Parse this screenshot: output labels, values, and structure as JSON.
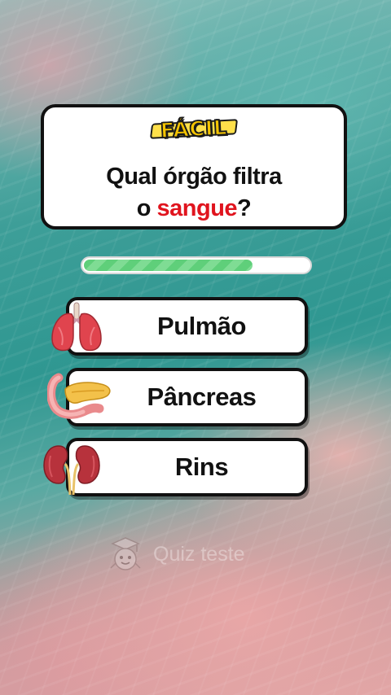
{
  "quiz": {
    "difficulty": "FÁCIL",
    "question_line1": "Qual órgão filtra",
    "question_prefix": "o ",
    "question_highlight": "sangue",
    "question_suffix": "?",
    "progress_fraction": 0.75,
    "options": [
      {
        "label": "Pulmão",
        "icon": "lungs-icon"
      },
      {
        "label": "Pâncreas",
        "icon": "pancreas-icon"
      },
      {
        "label": "Rins",
        "icon": "kidneys-icon"
      }
    ]
  },
  "watermark": {
    "text": "Quiz teste",
    "icon": "mascot-icon"
  },
  "colors": {
    "highlight": "#e0141e",
    "progress": "#5fcf7a",
    "badge": "#f5c400"
  }
}
